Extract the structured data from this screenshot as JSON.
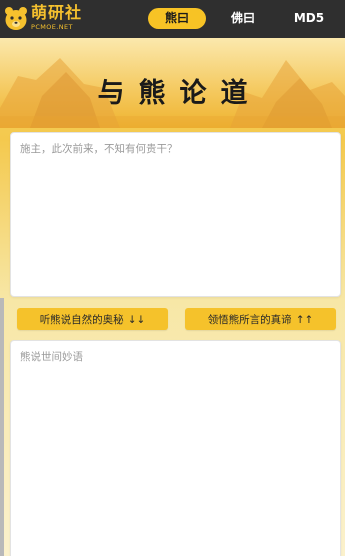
{
  "brand": {
    "name": "萌研社",
    "subtitle": "PCMOE.NET",
    "logo_icon": "bear-head-icon"
  },
  "nav": {
    "tabs": [
      {
        "label": "熊曰",
        "active": true
      },
      {
        "label": "佛曰",
        "active": false
      },
      {
        "label": "MD5",
        "active": false
      }
    ]
  },
  "hero": {
    "title": "与熊论道"
  },
  "input": {
    "placeholder": "施主，此次前来，不知有何贵干？",
    "value": ""
  },
  "actions": {
    "decode_label": "听熊说自然的奥秘",
    "decode_arrow": "↓↓",
    "encode_label": "领悟熊所言的真谛",
    "encode_arrow": "↑↑"
  },
  "output": {
    "placeholder": "熊说世间妙语",
    "value": ""
  },
  "colors": {
    "navbar": "#2f2f2f",
    "accent": "#f7c325",
    "button": "#f5c22b",
    "background": "#f6d66a"
  }
}
